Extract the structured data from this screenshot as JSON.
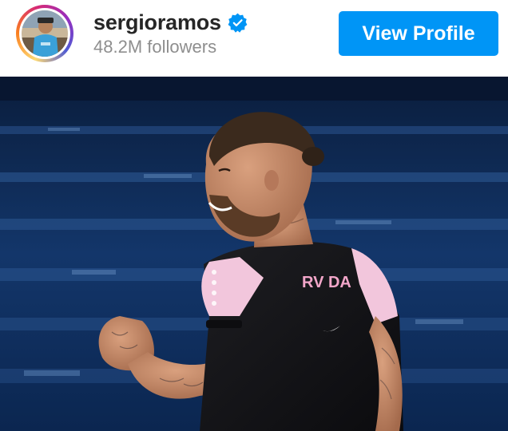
{
  "post_header": {
    "username": "sergioramos",
    "verified": true,
    "followers": "48.2M followers",
    "view_profile_label": "View Profile"
  },
  "photo": {
    "jersey_text": "RV  DA"
  },
  "colors": {
    "button_bg": "#0095f6",
    "button_text": "#ffffff",
    "username": "#262626",
    "followers": "#8e8e8e",
    "verified_badge": "#0095f6"
  },
  "icons": {
    "verified": "verified-badge-icon",
    "avatar": "profile-avatar"
  }
}
